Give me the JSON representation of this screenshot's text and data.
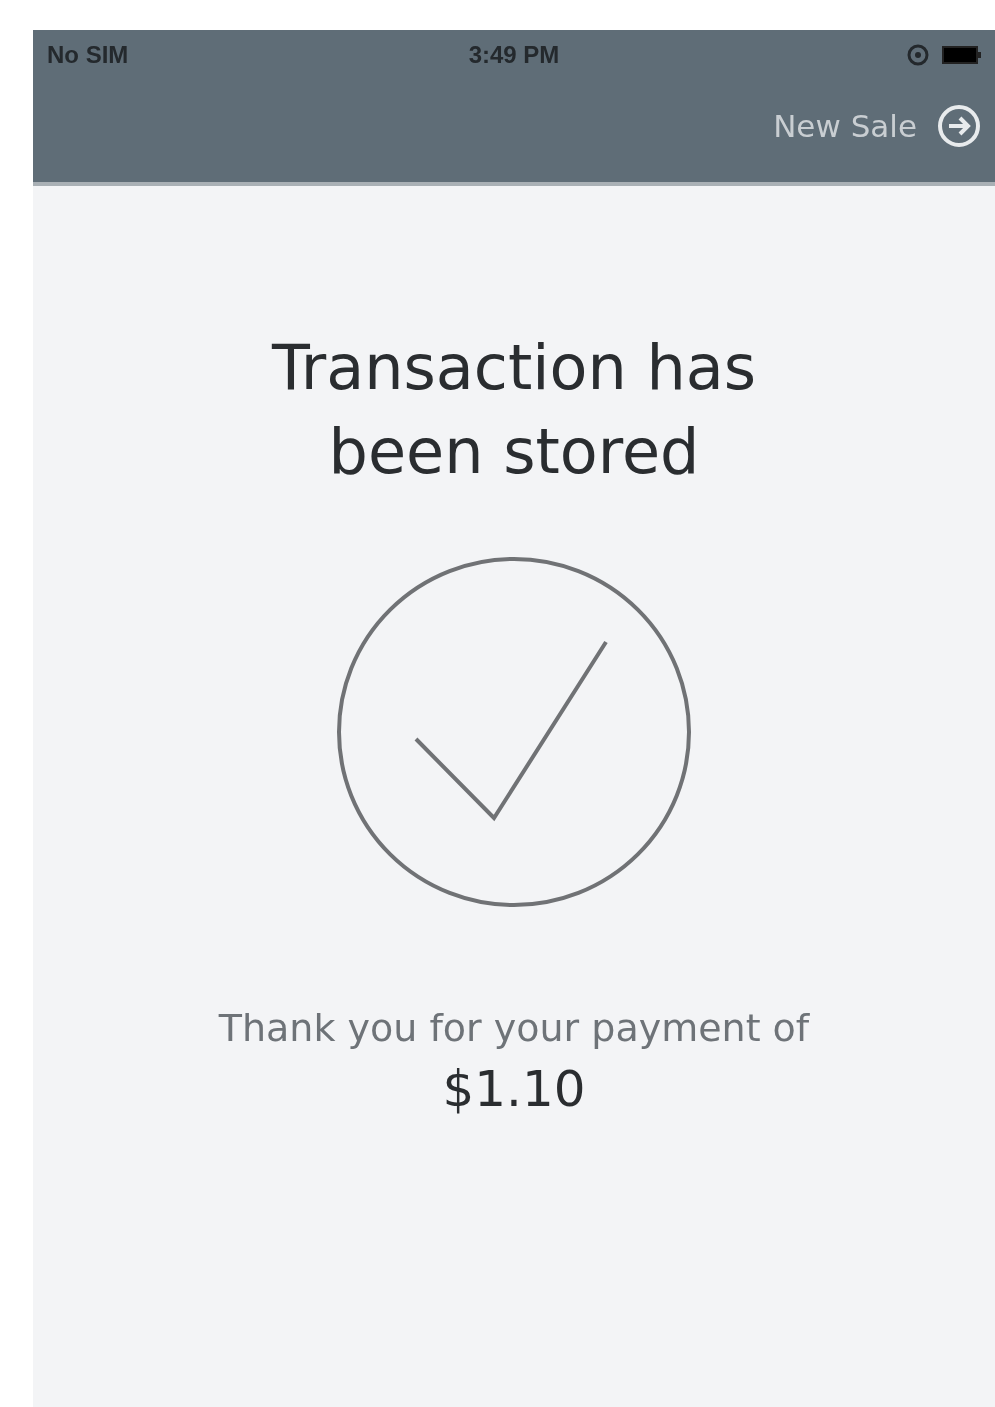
{
  "status_bar": {
    "carrier": "No SIM",
    "time": "3:49 PM"
  },
  "nav_bar": {
    "action": "New Sale"
  },
  "content": {
    "title": "Transaction has been stored",
    "message": "Thank you for your payment of",
    "amount": "$1.10"
  }
}
